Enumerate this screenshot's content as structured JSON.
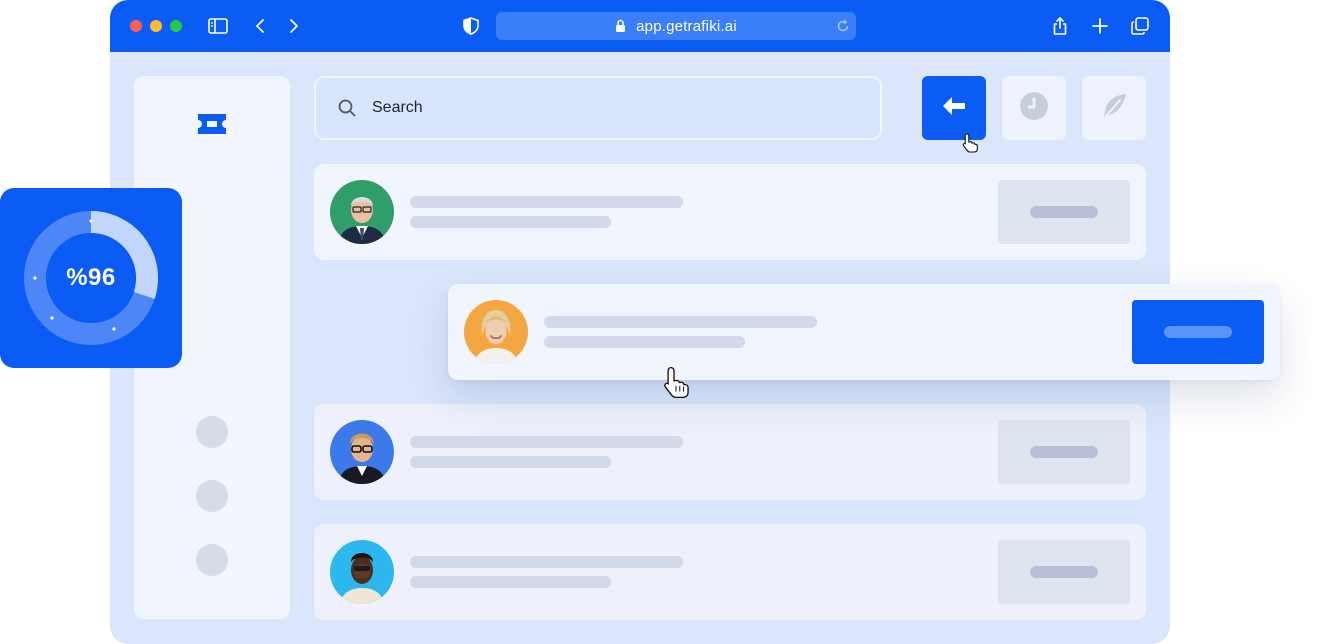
{
  "browser": {
    "url": "app.getrafiki.ai",
    "icons": [
      "sidebar-toggle-icon",
      "back-icon",
      "forward-icon",
      "shield-icon",
      "lock-icon",
      "reload-icon",
      "share-icon",
      "new-tab-icon",
      "tabs-icon"
    ]
  },
  "sidebar": {
    "logo_icon": "ticket-icon",
    "items": [
      "nav-item",
      "nav-item",
      "nav-item"
    ]
  },
  "search": {
    "placeholder": "Search"
  },
  "toolbar": {
    "buttons": [
      "arrow-left-icon",
      "clock-icon",
      "feather-icon"
    ]
  },
  "stat_card": {
    "value": "%96",
    "progress_fraction": 0.96
  },
  "list": {
    "rows": [
      {
        "avatar": "avatar-man-glasses-suit"
      },
      {
        "avatar": "avatar-woman-smiling",
        "selected": true
      },
      {
        "avatar": "avatar-man-glasses-blue"
      },
      {
        "avatar": "avatar-person-covering-face"
      }
    ]
  },
  "colors": {
    "accent": "#0a5cf5",
    "background": "#dbe6fc",
    "panel": "#f1f5fe"
  }
}
